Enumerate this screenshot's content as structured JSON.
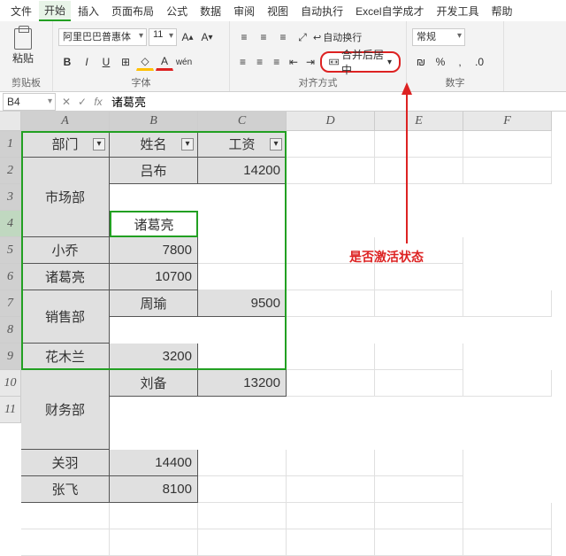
{
  "menu": [
    "文件",
    "开始",
    "插入",
    "页面布局",
    "公式",
    "数据",
    "审阅",
    "视图",
    "自动执行",
    "Excel自学成才",
    "开发工具",
    "帮助"
  ],
  "active_menu": 1,
  "ribbon": {
    "paste_label": "粘贴",
    "clipboard_label": "剪贴板",
    "font_name": "阿里巴巴普惠体",
    "font_size": "11",
    "font_group_label": "字体",
    "wrap_label": "自动换行",
    "merge_label": "合并后居中",
    "align_group_label": "对齐方式",
    "num_format": "常规",
    "num_group_label": "数字"
  },
  "namebox": "B4",
  "formula": "诸葛亮",
  "columns": [
    "A",
    "B",
    "C",
    "D",
    "E",
    "F"
  ],
  "sel_cols": [
    0,
    1,
    2
  ],
  "sel_rows": [
    1,
    2,
    3,
    4,
    5,
    6,
    7,
    8,
    9
  ],
  "active_row": 4,
  "headers": [
    "部门",
    "姓名",
    "工资"
  ],
  "rows": [
    {
      "dept": "市场部",
      "span": 3,
      "name": "吕布",
      "sal": "14200"
    },
    {
      "name": "小乔",
      "sal": "7800"
    },
    {
      "name": "诸葛亮",
      "sal": "10700"
    },
    {
      "dept": "销售部",
      "span": 2,
      "name": "周瑜",
      "sal": "9500"
    },
    {
      "name": "花木兰",
      "sal": "3200"
    },
    {
      "dept": "财务部",
      "span": 3,
      "name": "刘备",
      "sal": "13200"
    },
    {
      "name": "关羽",
      "sal": "14400"
    },
    {
      "name": "张飞",
      "sal": "8100"
    }
  ],
  "blank_rows": [
    10,
    11
  ],
  "annotation": "是否激活状态"
}
